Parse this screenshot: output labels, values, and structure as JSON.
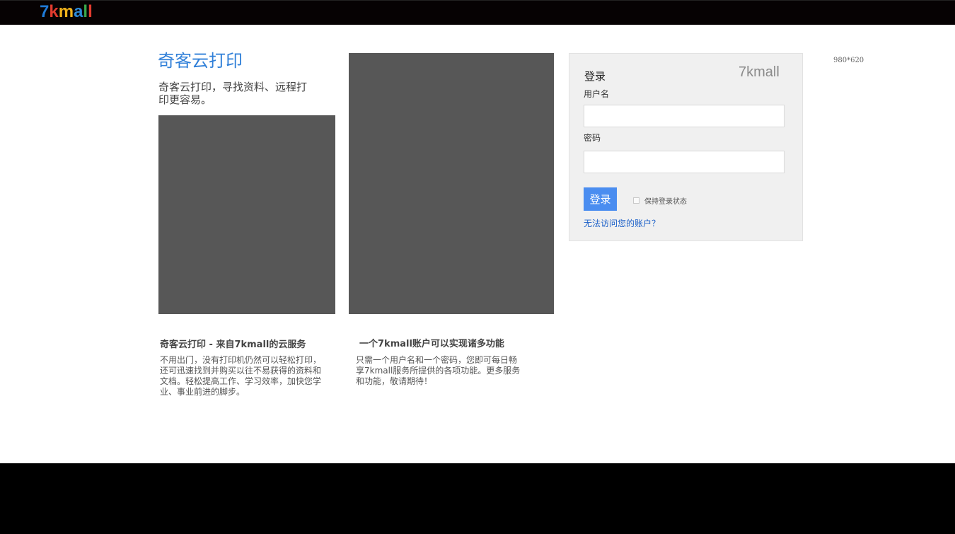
{
  "header": {
    "logo_chars": [
      "7",
      "k",
      "m",
      "a",
      "l",
      "l"
    ],
    "logo_colors": [
      "#1f7ad6",
      "#e23b2e",
      "#f0b21b",
      "#2c8ad8",
      "#3aa84b",
      "#e23b2e"
    ]
  },
  "brand": {
    "title": "奇客云打印",
    "subtitle": "奇客云打印，寻找资料、远程打印更容易。"
  },
  "features": [
    {
      "title": "奇客云打印 - 来自7kmall的云服务",
      "text": "不用出门，没有打印机仍然可以轻松打印，还可迅速找到并购买以往不易获得的资料和文档。轻松提高工作、学习效率，加快您学业、事业前进的脚步。"
    },
    {
      "title": "一个7kmall账户可以实现诸多功能",
      "text": "只需一个用户名和一个密码，您即可每日畅享7kmall服务所提供的各项功能。更多服务和功能，敬请期待！"
    }
  ],
  "login": {
    "title": "登录",
    "brand": "7kmall",
    "username_label": "用户名",
    "username_value": "",
    "password_label": "密码",
    "password_value": "",
    "submit_label": "登录",
    "remember_label": "保持登录状态",
    "forgot_link": "无法访问您的账户？"
  },
  "size_note": "980*620",
  "colors": {
    "accent": "#2f7fd8",
    "button": "#4a8df0",
    "link": "#1a5fc8",
    "placeholder_image": "#575757"
  }
}
